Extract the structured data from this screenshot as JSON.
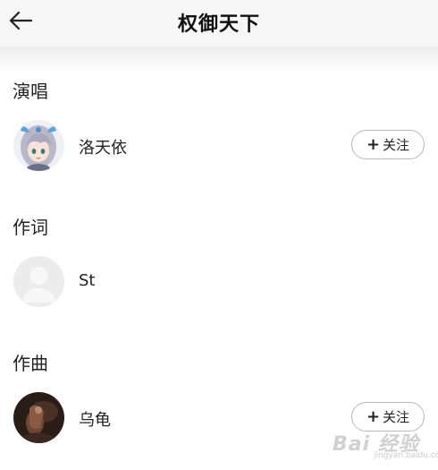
{
  "header": {
    "title": "权御天下",
    "back_icon": "arrow-left-icon"
  },
  "sections": [
    {
      "title": "演唱",
      "person": {
        "name": "洛天依",
        "avatar": "anime-girl-avatar",
        "follow_label": "关注"
      }
    },
    {
      "title": "作词",
      "person": {
        "name": "St",
        "avatar": "default-user-avatar"
      }
    },
    {
      "title": "作曲",
      "person": {
        "name": "乌龟",
        "avatar": "dark-photo-avatar",
        "follow_label": "关注"
      }
    }
  ],
  "watermark": {
    "brand": "Bai 经验",
    "sub": "jingyan.baidu.com"
  }
}
